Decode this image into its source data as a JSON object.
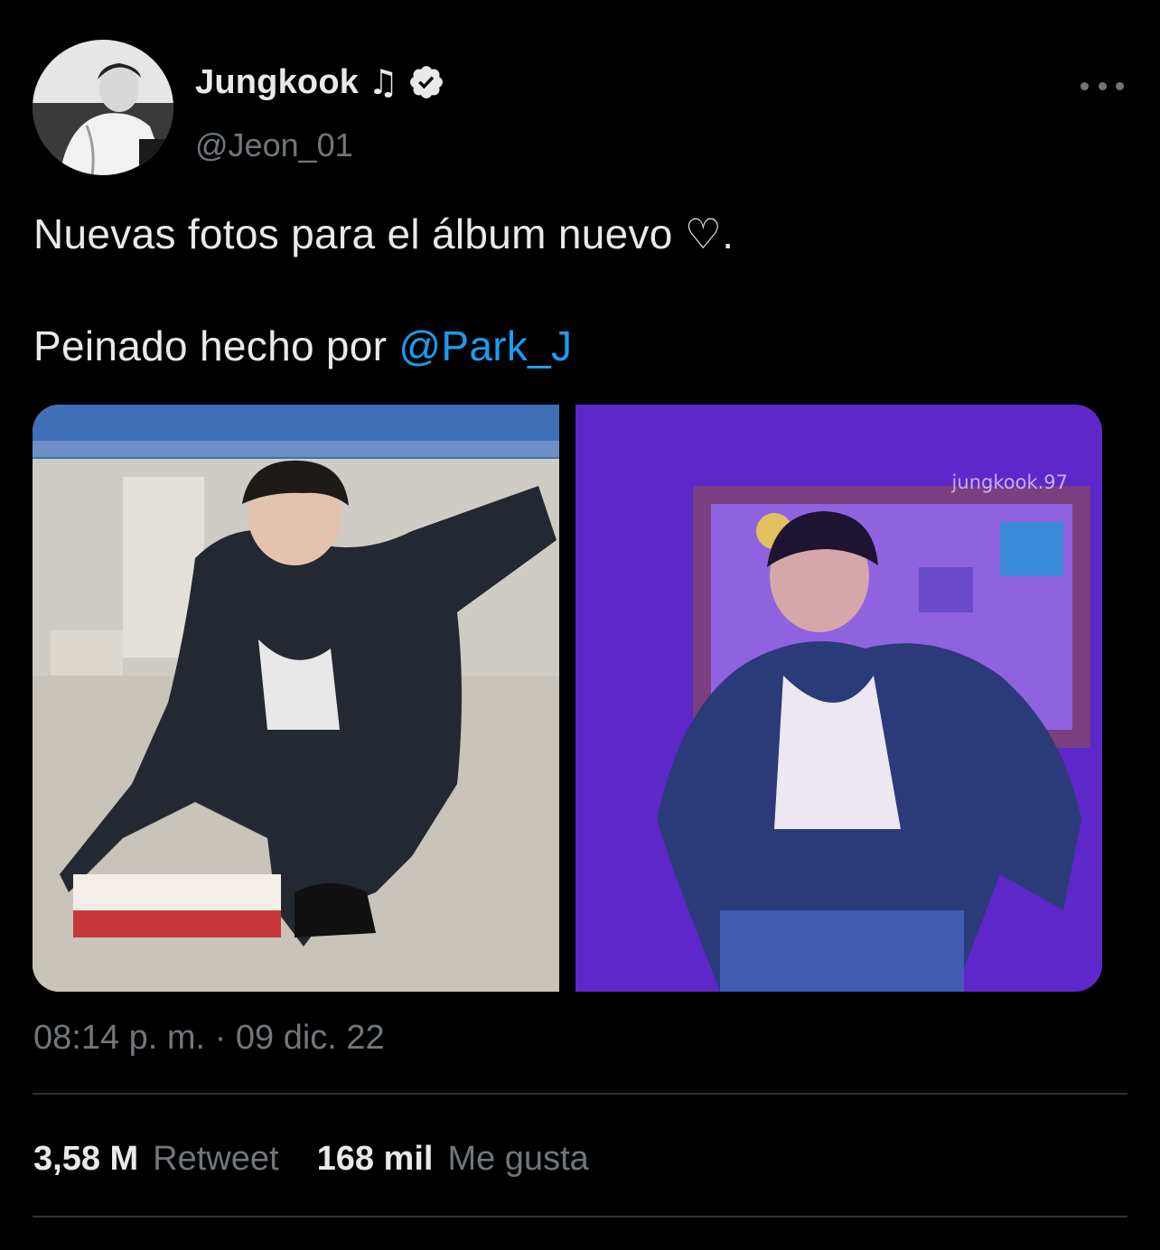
{
  "author": {
    "display_name": "Jungkook",
    "badge_icon": "music-note-icon",
    "badge_glyph": "♫",
    "verified": true,
    "handle": "@Jeon_01"
  },
  "tweet": {
    "line1": "Nuevas fotos para el álbum nuevo ♡.",
    "line2_prefix": "Peinado hecho por ",
    "mention": "@Park_J"
  },
  "media": {
    "count": 2,
    "watermark": "jungkook.97"
  },
  "timestamp": "08:14 p. m. · 09 dic. 22",
  "stats": {
    "retweets_count": "3,58 M",
    "retweets_label": "Retweet",
    "likes_count": "168 mil",
    "likes_label": "Me gusta"
  },
  "colors": {
    "background": "#000000",
    "text": "#e7e9ea",
    "secondary": "#71767b",
    "accent": "#1d9bf0",
    "divider": "#2f3336"
  }
}
